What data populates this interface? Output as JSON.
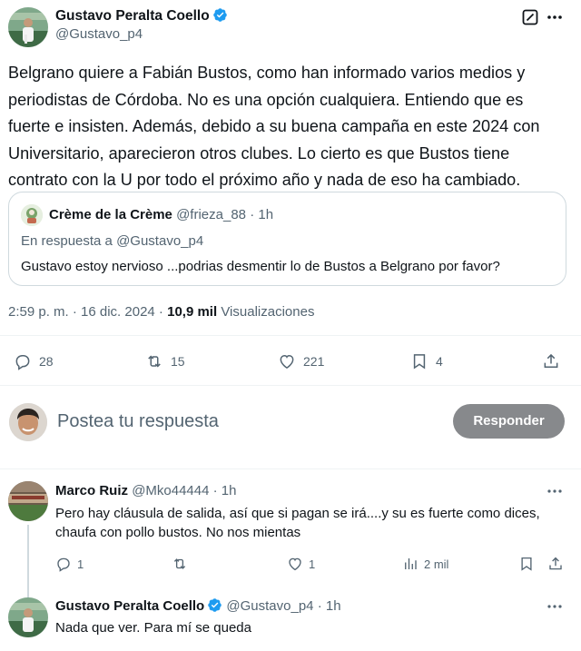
{
  "tweet": {
    "author_name": "Gustavo Peralta Coello",
    "author_handle": "@Gustavo_p4",
    "text": "Belgrano quiere a Fabián Bustos, como han informado varios medios y periodistas de Córdoba. No es una opción cualquiera. Entiendo que es fuerte e insisten. Además, debido a su buena campaña en este 2024 con Universitario, aparecieron otros clubes. Lo cierto es que Bustos tiene contrato con la U por todo el próximo año y nada de eso ha cambiado.",
    "quote": {
      "author_name": "Crème de la Crème",
      "author_handle": "@frieza_88",
      "time": "· 1h",
      "reply_to": "En respuesta a @Gustavo_p4",
      "text": "Gustavo estoy nervioso ...podrias desmentir lo de Bustos a Belgrano por favor?"
    },
    "timestamp": "2:59 p. m. · 16 dic. 2024 ·",
    "views_count": "10,9 mil",
    "views_label": "Visualizaciones",
    "stats": {
      "replies": "28",
      "reposts": "15",
      "likes": "221",
      "bookmarks": "4"
    }
  },
  "composer": {
    "placeholder": "Postea tu respuesta",
    "button_label": "Responder"
  },
  "replies": [
    {
      "author_name": "Marco Ruiz",
      "author_handle": "@Mko44444",
      "time": "· 1h",
      "text": "Pero hay cláusula de salida, así que si pagan se irá....y su es fuerte como dices, chaufa con pollo bustos. No nos mientas",
      "stats": {
        "replies": "1",
        "reposts": "",
        "likes": "1",
        "views": "2 mil"
      }
    },
    {
      "author_name": "Gustavo Peralta Coello",
      "author_handle": "@Gustavo_p4",
      "time": "· 1h",
      "text": "Nada que ver. Para mí se queda"
    }
  ],
  "colors": {
    "verified_blue": "#1d9bf0",
    "button_gray": "#87898c",
    "text_muted": "#536471"
  }
}
